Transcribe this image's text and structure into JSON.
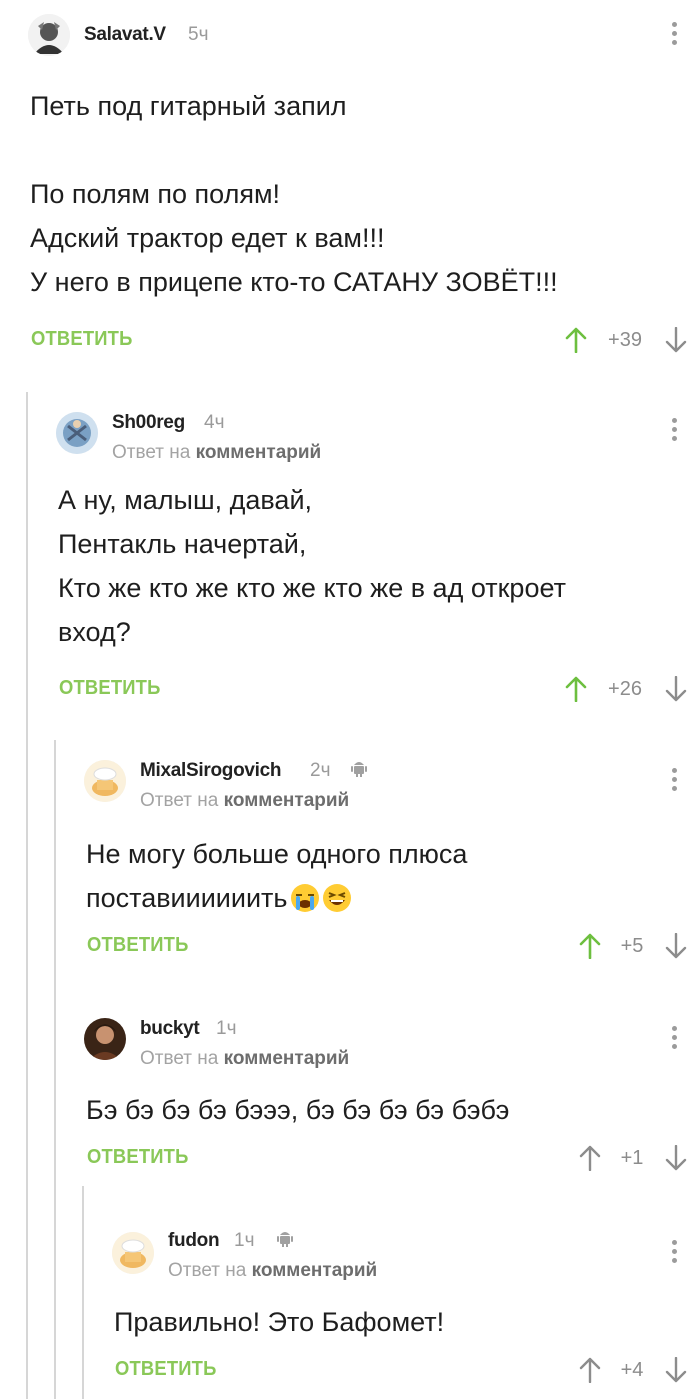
{
  "comments": [
    {
      "username": "Salavat.V",
      "time": "5ч",
      "text": "Петь под гитарный запил\n\nПо полям по полям!\nАдский трактор едет к вам!!!\nУ него в прицепе кто-то САТАНУ ЗОВЁТ!!!",
      "reply_label": "ОТВЕТИТЬ",
      "score": "+39",
      "upvoted": true
    },
    {
      "username": "Sh00reg",
      "time": "4ч",
      "reply_to_prefix": "Ответ на",
      "reply_to_link": "комментарий",
      "text": "А ну, малыш, давай,\nПентакль начертай,\nКто же кто же кто же кто же в ад откроет\nвход?",
      "reply_label": "ОТВЕТИТЬ",
      "score": "+26",
      "upvoted": true
    },
    {
      "username": "MixalSirogovich",
      "time": "2ч",
      "reply_to_prefix": "Ответ на",
      "reply_to_link": "комментарий",
      "text_line1": "Не могу больше одного плюса",
      "text_line2": "поставиииииить",
      "emojis": [
        "loudly-crying-face",
        "grinning-squinting-face"
      ],
      "reply_label": "ОТВЕТИТЬ",
      "score": "+5",
      "upvoted": true
    },
    {
      "username": "buckyt",
      "time": "1ч",
      "reply_to_prefix": "Ответ на",
      "reply_to_link": "комментарий",
      "text": "Бэ бэ бэ бэ бэээ, бэ бэ бэ бэ бэбэ",
      "reply_label": "ОТВЕТИТЬ",
      "score": "+1",
      "upvoted": false
    },
    {
      "username": "fudon",
      "time": "1ч",
      "reply_to_prefix": "Ответ на",
      "reply_to_link": "комментарий",
      "text": "Правильно! Это Бафомет!",
      "reply_label": "ОТВЕТИТЬ",
      "score": "+4",
      "upvoted": false
    }
  ],
  "colors": {
    "accent_green": "#8ac858",
    "upvote_active": "#6dbf3f",
    "neutral_arrow": "#8c8c8c"
  }
}
